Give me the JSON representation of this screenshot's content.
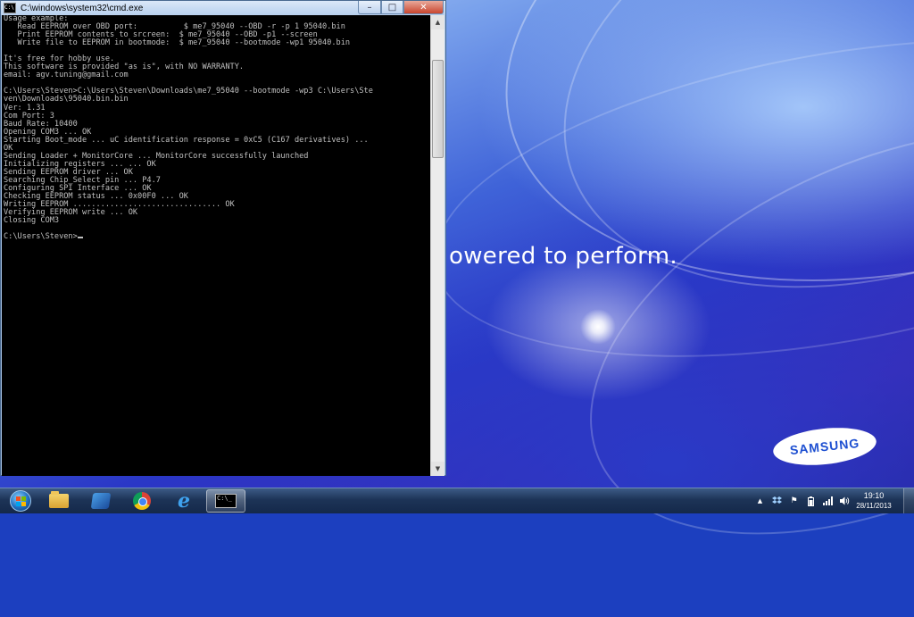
{
  "desktop": {
    "tagline": "owered to perform.",
    "logo_text": "SAMSUNG"
  },
  "cmd_window": {
    "title": "C:\\windows\\system32\\cmd.exe",
    "icon": "cmd-icon",
    "controls": {
      "minimize": "–",
      "maximize": "□",
      "close": "✕"
    },
    "console_lines": [
      "Usage example:",
      "   Read EEPROM over OBD port:          $ me7_95040 --OBD -r -p 1 95040.bin",
      "   Print EEPROM contents to srcreen:  $ me7_95040 --OBD -p1 --screen",
      "   Write file to EEPROM in bootmode:  $ me7_95040 --bootmode -wp1 95040.bin",
      "",
      "It's free for hobby use.",
      "This software is provided \"as is\", with NO WARRANTY.",
      "email: agv.tuning@gmail.com",
      "",
      "C:\\Users\\Steven>C:\\Users\\Steven\\Downloads\\me7_95040 --bootmode -wp3 C:\\Users\\Ste",
      "ven\\Downloads\\95040.bin.bin",
      "Ver: 1.31",
      "Com Port: 3",
      "Baud Rate: 10400",
      "Opening COM3 ... OK",
      "Starting Boot_mode ... uC identification response = 0xC5 (C167 derivatives) ...",
      "OK",
      "Sending Loader + MonitorCore ... MonitorCore successfully launched",
      "Initializing registers ... ... OK",
      "Sending EEPROM driver ... OK",
      "Searching Chip_Select pin ... P4.7",
      "Configuring SPI Interface ... OK",
      "Checking EEPROM status ... 0x00F0 ... OK",
      "Writing EEPROM ................................ OK",
      "Verifying EEPROM write ... OK",
      "Closing COM3",
      "",
      "C:\\Users\\Steven>"
    ],
    "scrollbar": {
      "up_arrow": "▲",
      "down_arrow": "▼"
    }
  },
  "taskbar": {
    "start_icon": "windows-orb-icon",
    "pinned": [
      {
        "name": "windows-explorer",
        "icon": "folder-icon"
      },
      {
        "name": "windows-media-player",
        "icon": "media-player-icon"
      },
      {
        "name": "google-chrome",
        "icon": "chrome-icon"
      },
      {
        "name": "internet-explorer",
        "icon": "ie-icon",
        "glyph": "e"
      },
      {
        "name": "command-prompt",
        "icon": "cmd-icon",
        "active": true
      }
    ],
    "tray": {
      "icons": [
        "show-hidden-icons-arrow",
        "dropbox-icon",
        "action-center-flag-icon",
        "battery-icon",
        "network-signal-icon",
        "volume-icon"
      ],
      "glyphs": {
        "arrow": "▲",
        "flag": "⚑",
        "volume": "🔈"
      },
      "time": "19:10",
      "date": "28/11/2013"
    }
  }
}
